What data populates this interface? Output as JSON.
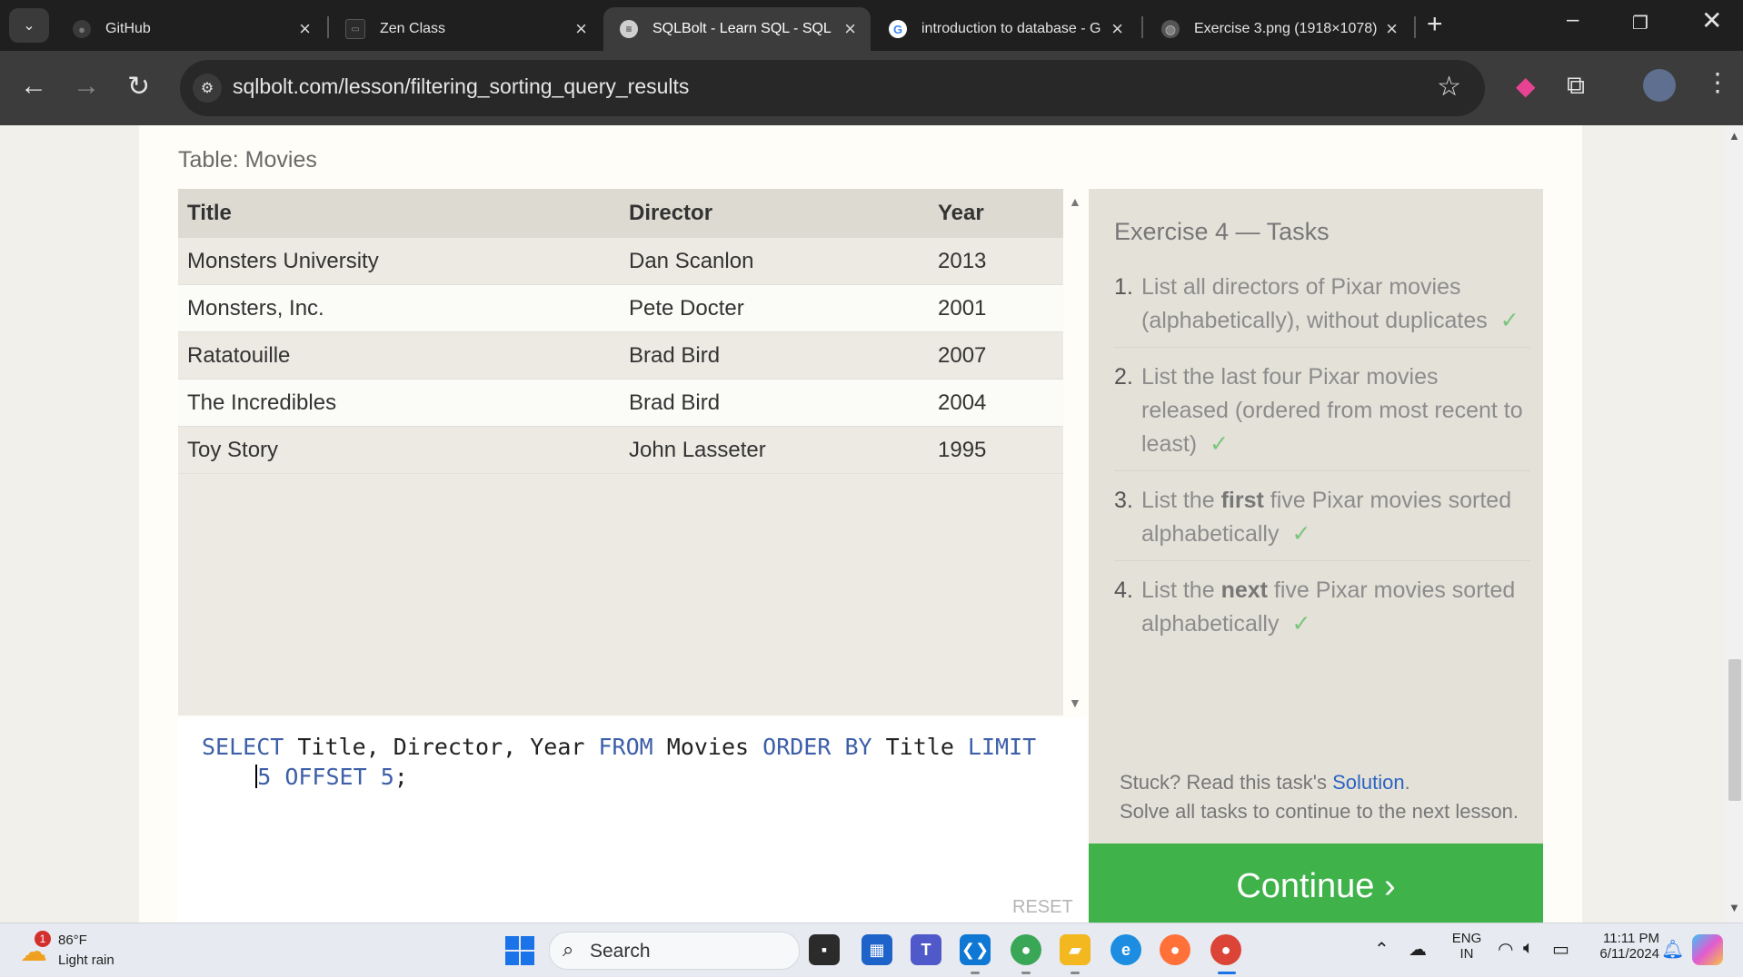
{
  "browser": {
    "tabs": [
      {
        "label": "GitHub",
        "icon": "github-icon",
        "active": false
      },
      {
        "label": "Zen Class",
        "icon": "zen-class-icon",
        "active": false
      },
      {
        "label": "SQLBolt - Learn SQL - SQL L",
        "icon": "database-icon",
        "active": true
      },
      {
        "label": "introduction to database - G",
        "icon": "google-icon",
        "active": false
      },
      {
        "label": "Exercise 3.png (1918×1078)",
        "icon": "globe-icon",
        "active": false
      }
    ],
    "url": "sqlbolt.com/lesson/filtering_sorting_query_results"
  },
  "page": {
    "table_caption": "Table: Movies",
    "table": {
      "headers": [
        "Title",
        "Director",
        "Year"
      ],
      "rows": [
        [
          "Monsters University",
          "Dan Scanlon",
          "2013"
        ],
        [
          "Monsters, Inc.",
          "Pete Docter",
          "2001"
        ],
        [
          "Ratatouille",
          "Brad Bird",
          "2007"
        ],
        [
          "The Incredibles",
          "Brad Bird",
          "2004"
        ],
        [
          "Toy Story",
          "John Lasseter",
          "1995"
        ]
      ]
    },
    "query": {
      "line1": {
        "kw_select": "SELECT",
        "cols": " Title, Director, Year ",
        "kw_from": "FROM",
        "table": " Movies ",
        "kw_order": "ORDER BY",
        "order_col": " Title ",
        "kw_limit": "LIMIT"
      },
      "line2": {
        "limit_val": "5",
        "kw_offset": " OFFSET ",
        "offset_val": "5",
        "end": ";"
      }
    },
    "reset_label": "RESET",
    "exercise": {
      "heading": "Exercise 4 — Tasks",
      "tasks": [
        {
          "num": "1.",
          "before": "List all directors of Pixar movies (alphabetically), without duplicates",
          "bold": "",
          "after": "",
          "check": "✓"
        },
        {
          "num": "2.",
          "before": "List the last four Pixar movies released (ordered from most recent to least)",
          "bold": "",
          "after": "",
          "check": "✓"
        },
        {
          "num": "3.",
          "before": "List the ",
          "bold": "first",
          "after": " five Pixar movies sorted alphabetically",
          "check": "✓"
        },
        {
          "num": "4.",
          "before": "List the ",
          "bold": "next",
          "after": " five Pixar movies sorted alphabetically",
          "check": "✓"
        }
      ]
    },
    "help": {
      "stuck_prefix": "Stuck? Read this task's ",
      "solution_link": "Solution",
      "stuck_suffix": ".",
      "continue_note": "Solve all tasks to continue to the next lesson."
    },
    "continue_label": "Continue ›"
  },
  "taskbar": {
    "weather": {
      "badge": "1",
      "temp": "86°F",
      "desc": "Light rain"
    },
    "search_label": "Search",
    "lang": {
      "line1": "ENG",
      "line2": "IN"
    },
    "clock": {
      "time": "11:11 PM",
      "date": "6/11/2024"
    }
  },
  "colors": {
    "accent_green": "#3fb24a",
    "keyword_blue": "#3d5fa8",
    "link_blue": "#2d64c2"
  }
}
